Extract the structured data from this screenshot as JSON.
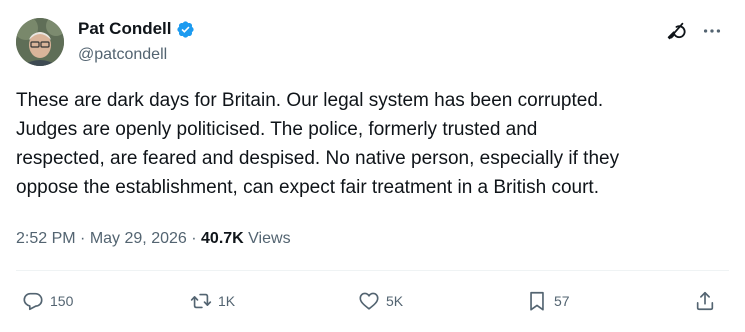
{
  "author": {
    "name": "Pat Condell",
    "handle": "@patcondell",
    "verified_color": "#1d9bf0"
  },
  "tweet": {
    "text": "These are dark days for Britain. Our legal system has been corrupted.\nJudges are openly politicised. The police, formerly trusted and\nrespected, are feared and despised. No native person, especially if they\noppose the establishment, can expect fair treatment in a British court."
  },
  "meta": {
    "time": "2:52 PM",
    "separator": "·",
    "date": "May 29, 2026",
    "views_count": "40.7K",
    "views_label": "Views"
  },
  "actions": {
    "reply_count": "150",
    "retweet_count": "1K",
    "like_count": "5K",
    "bookmark_count": "57"
  },
  "icons": {
    "grok": "grok-icon",
    "more": "more-icon",
    "reply": "reply-icon",
    "retweet": "retweet-icon",
    "like": "like-icon",
    "bookmark": "bookmark-icon",
    "share": "share-icon"
  }
}
